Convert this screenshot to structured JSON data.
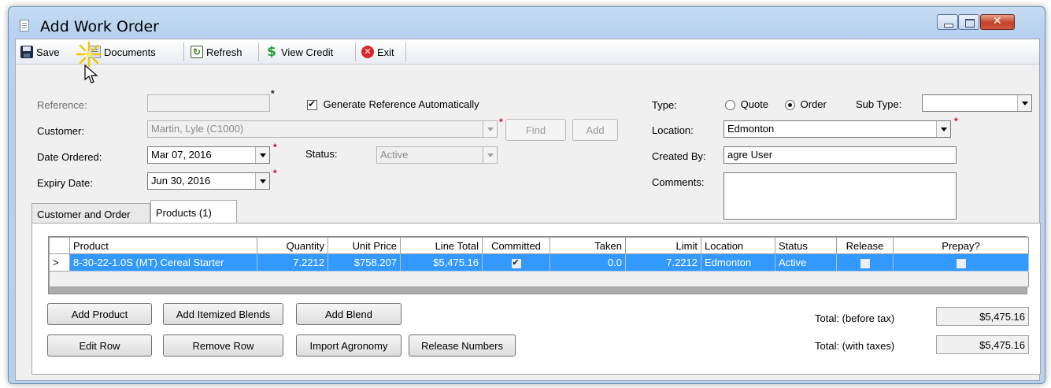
{
  "window": {
    "title": "Add Work Order"
  },
  "toolbar": {
    "save": "Save",
    "documents": "Documents",
    "refresh": "Refresh",
    "view_credit": "View Credit",
    "exit": "Exit"
  },
  "form": {
    "reference_label": "Reference:",
    "reference_value": "",
    "generate_ref_label": "Generate Reference Automatically",
    "customer_label": "Customer:",
    "customer_value": "Martin, Lyle (C1000)",
    "find_button": "Find",
    "add_button": "Add",
    "date_ordered_label": "Date Ordered:",
    "date_ordered_value": "Mar 07, 2016",
    "status_label": "Status:",
    "status_value": "Active",
    "expiry_label": "Expiry Date:",
    "expiry_value": "Jun 30, 2016",
    "type_label": "Type:",
    "type_quote": "Quote",
    "type_order": "Order",
    "subtype_label": "Sub Type:",
    "subtype_value": "",
    "location_label": "Location:",
    "location_value": "Edmonton",
    "created_by_label": "Created By:",
    "created_by_value": "agre User",
    "comments_label": "Comments:",
    "comments_value": ""
  },
  "tabs": [
    "Customer and Order",
    "Products (1)"
  ],
  "grid": {
    "columns": [
      "Product",
      "Quantity",
      "Unit Price",
      "Line Total",
      "Committed",
      "Taken",
      "Limit",
      "Location",
      "Status",
      "Release",
      "Prepay?"
    ],
    "rows": [
      {
        "marker": ">",
        "product": "8-30-22-1.0S (MT) Cereal Starter",
        "quantity": "7.2212",
        "unit_price": "$758.207",
        "line_total": "$5,475.16",
        "committed": true,
        "taken": "0.0",
        "limit": "7.2212",
        "location": "Edmonton",
        "status": "Active",
        "release": false,
        "prepay": false
      }
    ]
  },
  "buttons": {
    "add_product": "Add Product",
    "add_itemized_blends": "Add Itemized Blends",
    "add_blend": "Add Blend",
    "edit_row": "Edit Row",
    "remove_row": "Remove Row",
    "import_agronomy": "Import Agronomy",
    "release_numbers": "Release Numbers"
  },
  "totals": {
    "before_tax_label": "Total: (before tax)",
    "before_tax_value": "$5,475.16",
    "with_taxes_label": "Total: (with taxes)",
    "with_taxes_value": "$5,475.16"
  },
  "icons": {
    "window": "document-icon",
    "save": "floppy-disk-icon",
    "documents": "documents-icon",
    "refresh": "refresh-icon",
    "view_credit": "dollar-icon",
    "exit": "close-circle-icon"
  }
}
